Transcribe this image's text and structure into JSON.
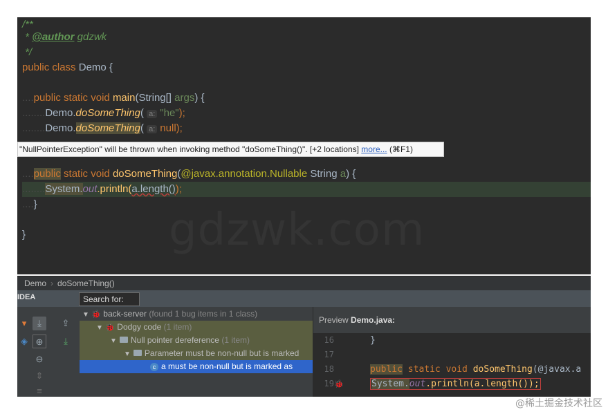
{
  "editor": {
    "javadoc_open": "/**",
    "javadoc_star": " * ",
    "author_tag": "@author",
    "author_name": "gdzwk",
    "javadoc_close": " */",
    "kw_public": "public",
    "kw_class": "class",
    "class_name": "Demo",
    "open_brace": "{",
    "close_brace": "}",
    "kw_static": "static",
    "kw_void": "void",
    "main_name": "main",
    "main_params_open": "(String[] ",
    "main_param_name": "args",
    "main_params_close": ") {",
    "call_prefix": "Demo.",
    "call_method": "doSomeThing",
    "paren_open": "(",
    "hint_label": "a:",
    "call1_arg": "\"he\"",
    "call2_arg": "null",
    "call_close": ");",
    "method_name": "doSomeThing",
    "method_sig_open": "(",
    "annotation": "@javax.annotation.Nullable",
    "param_type": " String ",
    "param_name": "a",
    "method_sig_close": ") {",
    "print_system": "System.",
    "print_out": "out",
    "print_call": ".println(",
    "print_arg": "a.length()",
    "print_close": ");"
  },
  "tooltip": {
    "text": "\"NullPointerException\" will be thrown when invoking method \"doSomeThing()\". [+2 locations] ",
    "more_link": "more...",
    "shortcut": " (⌘F1)"
  },
  "watermark": "gdzwk.com",
  "breadcrumb": {
    "class": "Demo",
    "method": "doSomeThing()"
  },
  "toolwindow": {
    "title": "IDEA",
    "search_label": "Search for:",
    "tree": [
      {
        "label": "back-server",
        "detail": " (found 1 bug items in 1 class)"
      },
      {
        "label": "Dodgy code",
        "detail": " (1 item)"
      },
      {
        "label": "Null pointer dereference",
        "detail": " (1 item)"
      },
      {
        "label": "Parameter must be non-null but is marked"
      },
      {
        "label": "a must be non-null but is marked as"
      }
    ],
    "preview": {
      "label": "Preview",
      "file": "Demo.java:",
      "lines": [
        {
          "num": "16",
          "code": "}"
        },
        {
          "num": "17",
          "code": ""
        },
        {
          "num": "18",
          "kw1": "public",
          "kw2": " static void ",
          "fn": "doSomeThing",
          "rest": "(@javax.a"
        },
        {
          "num": "19",
          "sys": "System.",
          "out": "out",
          "call": ".println(a.length());"
        }
      ]
    }
  },
  "csdn_watermark": "@稀土掘金技术社区",
  "colors": {
    "editor_bg": "#2b2b2b",
    "keyword": "#cc7832",
    "string": "#6a8759",
    "method": "#ffc66d",
    "selection": "#2f65ca"
  }
}
